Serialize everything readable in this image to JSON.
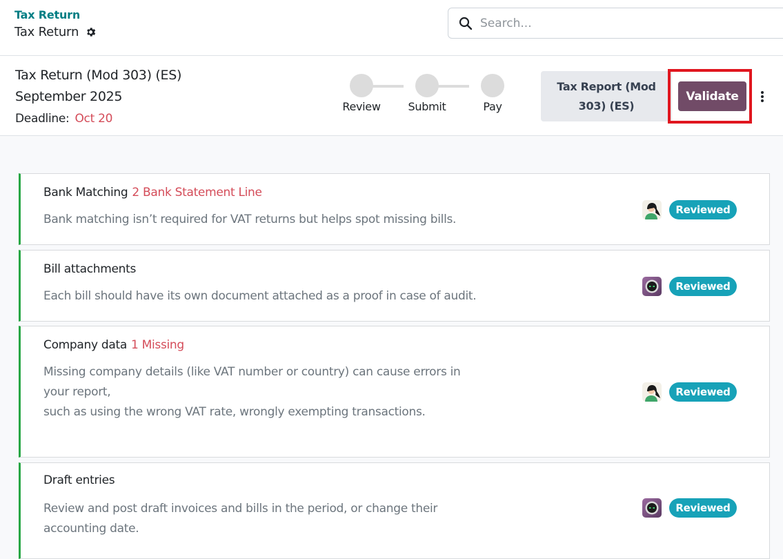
{
  "breadcrumb": {
    "parent": "Tax Return",
    "current": "Tax Return"
  },
  "search": {
    "placeholder": "Search...",
    "value": ""
  },
  "return": {
    "title": "Tax Return (Mod 303) (ES)",
    "period": "September 2025",
    "deadline_label": "Deadline:",
    "deadline_value": "Oct 20"
  },
  "steps": [
    {
      "label": "Review"
    },
    {
      "label": "Submit"
    },
    {
      "label": "Pay"
    }
  ],
  "actions": {
    "report_label": "Tax Report (Mod 303) (ES)",
    "validate_label": "Validate"
  },
  "checks": [
    {
      "title": "Bank Matching",
      "warning": "2 Bank Statement Line",
      "description": [
        "Bank matching isn’t required for VAT returns but helps spot missing bills."
      ],
      "avatar": "user-avatar-woman",
      "status": "Reviewed"
    },
    {
      "title": "Bill attachments",
      "warning": "",
      "description": [
        "Each bill should have its own document attached as a proof in case of audit."
      ],
      "avatar": "user-avatar-bot",
      "status": "Reviewed"
    },
    {
      "title": "Company data",
      "warning": "1 Missing",
      "description": [
        "Missing company details (like VAT number or country) can cause errors in",
        "your report,",
        "such as using the wrong VAT rate, wrongly exempting transactions."
      ],
      "avatar": "user-avatar-woman",
      "status": "Reviewed"
    },
    {
      "title": "Draft entries",
      "warning": "",
      "description": [
        "Review and post draft invoices and bills in the period, or change their",
        "accounting date."
      ],
      "avatar": "user-avatar-bot",
      "status": "Reviewed"
    }
  ],
  "colors": {
    "brand_teal": "#017e84",
    "primary": "#714b67",
    "warning_text": "#d44c59",
    "success_border": "#28a745",
    "badge_info": "#17a2b8",
    "highlight": "#e0161f"
  }
}
